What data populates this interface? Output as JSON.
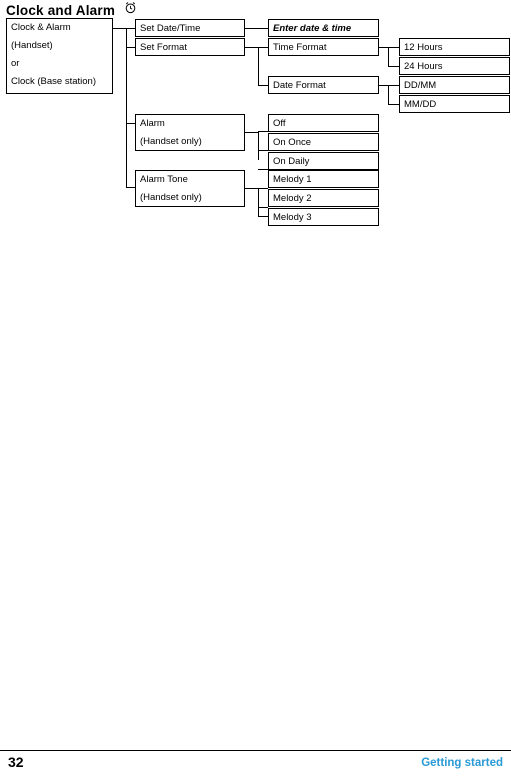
{
  "page": {
    "heading": "Clock and Alarm",
    "heading_icon": "alarm-clock-icon",
    "number": "32",
    "section": "Getting started"
  },
  "diagram": {
    "type": "menu-tree",
    "root": {
      "lines": [
        "Clock & Alarm",
        "(Handset)",
        "or",
        "Clock (Base station)"
      ]
    },
    "level1": [
      {
        "lines": [
          "Set Date/Time"
        ]
      },
      {
        "lines": [
          "Set Format"
        ]
      },
      {
        "lines": [
          "Alarm",
          "(Handset only)"
        ]
      },
      {
        "lines": [
          "Alarm Tone",
          "(Handset only)"
        ]
      }
    ],
    "level2": [
      {
        "lines": [
          "Enter date & time"
        ],
        "italic": true
      },
      {
        "lines": [
          "Time Format"
        ]
      },
      {
        "lines": [
          "Date Format"
        ]
      },
      {
        "lines": [
          "Off"
        ]
      },
      {
        "lines": [
          "On Once"
        ]
      },
      {
        "lines": [
          "On Daily"
        ]
      },
      {
        "lines": [
          "Melody 1"
        ]
      },
      {
        "lines": [
          "Melody 2"
        ]
      },
      {
        "lines": [
          "Melody 3"
        ]
      }
    ],
    "level3": [
      {
        "lines": [
          "12 Hours"
        ]
      },
      {
        "lines": [
          "24 Hours"
        ]
      },
      {
        "lines": [
          "DD/MM"
        ]
      },
      {
        "lines": [
          "MM/DD"
        ]
      }
    ]
  }
}
